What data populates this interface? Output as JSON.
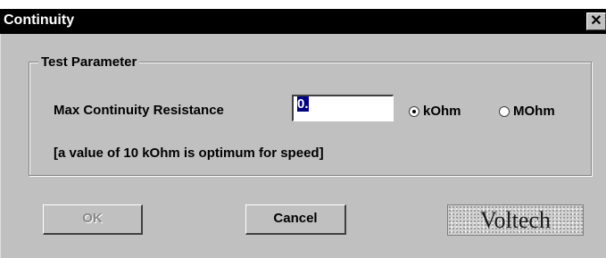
{
  "window": {
    "title": "Continuity",
    "close_glyph": "✕"
  },
  "group": {
    "label": "Test Parameter"
  },
  "max_resistance": {
    "label": "Max Continuity Resistance",
    "value": "0."
  },
  "units": {
    "kohm_label": "kOhm",
    "mohm_label": "MOhm",
    "selected": "kOhm"
  },
  "hint": "[a value of 10 kOhm is optimum for speed]",
  "buttons": {
    "ok_label": "OK",
    "ok_enabled": false,
    "cancel_label": "Cancel"
  },
  "logo": {
    "text": "Voltech"
  },
  "colors": {
    "titlebar": "#000000",
    "dialog_face": "#c0c0c0",
    "selection": "#000080"
  }
}
